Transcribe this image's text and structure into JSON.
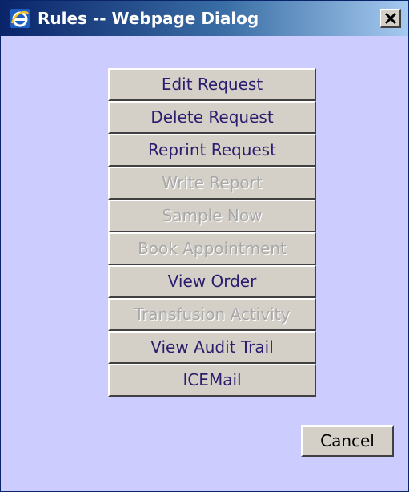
{
  "window": {
    "title": "Rules -- Webpage Dialog",
    "icon": "ie-icon",
    "close_icon": "close-icon"
  },
  "colors": {
    "dialog_background": "#ccccff",
    "button_face": "#d4d0c8",
    "enabled_text": "#2b1d6e",
    "disabled_text": "#a8a8a8",
    "titlebar_start": "#0a246a",
    "titlebar_end": "#a6caf0"
  },
  "rules": [
    {
      "label": "Edit Request",
      "enabled": true
    },
    {
      "label": "Delete Request",
      "enabled": true
    },
    {
      "label": "Reprint Request",
      "enabled": true
    },
    {
      "label": "Write Report",
      "enabled": false
    },
    {
      "label": "Sample Now",
      "enabled": false
    },
    {
      "label": "Book Appointment",
      "enabled": false
    },
    {
      "label": "View Order",
      "enabled": true
    },
    {
      "label": "Transfusion Activity",
      "enabled": false
    },
    {
      "label": "View Audit Trail",
      "enabled": true
    },
    {
      "label": "ICEMail",
      "enabled": true
    }
  ],
  "footer": {
    "cancel_label": "Cancel"
  }
}
